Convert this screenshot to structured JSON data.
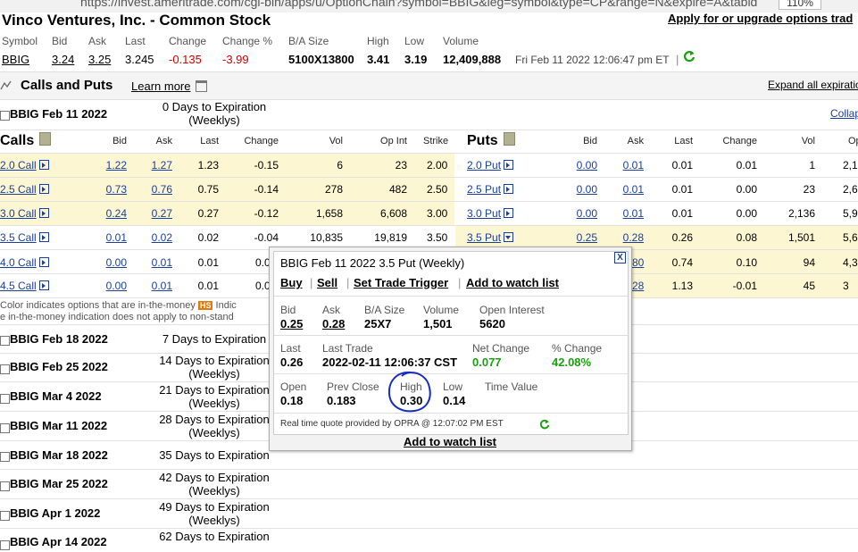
{
  "browser": {
    "url": "https://invest.ameritrade.com/cgi-bin/apps/u/OptionChain?symbol=BBIG&leg=symbol&type=CP&range=N&expire=A&tabid",
    "zoom": "110%"
  },
  "header": {
    "title": "Vinco Ventures, Inc. - Common Stock",
    "apply_link": "Apply for or upgrade options trad"
  },
  "quote": {
    "labels": {
      "symbol": "Symbol",
      "bid": "Bid",
      "ask": "Ask",
      "last": "Last",
      "change": "Change",
      "change_pct": "Change %",
      "ba_size": "B/A Size",
      "high": "High",
      "low": "Low",
      "volume": "Volume"
    },
    "values": {
      "symbol": "BBIG",
      "bid": "3.24",
      "ask": "3.25",
      "last": "3.245",
      "change": "-0.135",
      "change_pct": "-3.99",
      "ba_size": "5100X13800",
      "high": "3.41",
      "low": "3.19",
      "volume": "12,409,888",
      "timestamp": "Fri Feb 11 2022 12:06:47 pm ET",
      "pipe": "|"
    }
  },
  "section": {
    "title": "Calls and Puts",
    "learn_more": "Learn more",
    "expand_all": "Expand all expiratio"
  },
  "expiry_open": {
    "label": "BBIG Feb 11 2022",
    "days": "0 Days to Expiration",
    "weekly": "(Weeklys)",
    "collapse": "Collap"
  },
  "chain_headers": {
    "calls": "Calls",
    "puts": "Puts",
    "bid": "Bid",
    "ask": "Ask",
    "last": "Last",
    "change": "Change",
    "vol": "Vol",
    "op_int": "Op Int",
    "strike": "Strike"
  },
  "chain_rows": [
    {
      "call": "2.0 Call",
      "c_bid": "1.22",
      "c_ask": "1.27",
      "c_last": "1.23",
      "c_chg": "-0.15",
      "c_vol": "6",
      "c_oi": "23",
      "strike": "2.00",
      "put": "2.0 Put",
      "p_bid": "0.00",
      "p_ask": "0.01",
      "p_last": "0.01",
      "p_chg": "0.01",
      "p_vol": "1",
      "p_oi": "2,1"
    },
    {
      "call": "2.5 Call",
      "c_bid": "0.73",
      "c_ask": "0.76",
      "c_last": "0.75",
      "c_chg": "-0.14",
      "c_vol": "278",
      "c_oi": "482",
      "strike": "2.50",
      "put": "2.5 Put",
      "p_bid": "0.00",
      "p_ask": "0.01",
      "p_last": "0.01",
      "p_chg": "0.00",
      "p_vol": "23",
      "p_oi": "2,6"
    },
    {
      "call": "3.0 Call",
      "c_bid": "0.24",
      "c_ask": "0.27",
      "c_last": "0.27",
      "c_chg": "-0.12",
      "c_vol": "1,658",
      "c_oi": "6,608",
      "strike": "3.00",
      "put": "3.0 Put",
      "p_bid": "0.00",
      "p_ask": "0.01",
      "p_last": "0.01",
      "p_chg": "0.00",
      "p_vol": "2,136",
      "p_oi": "5,9"
    },
    {
      "call": "3.5 Call",
      "c_bid": "0.01",
      "c_ask": "0.02",
      "c_last": "0.02",
      "c_chg": "-0.04",
      "c_vol": "10,835",
      "c_oi": "19,819",
      "strike": "3.50",
      "put": "3.5 Put",
      "p_bid": "0.25",
      "p_ask": "0.28",
      "p_last": "0.26",
      "p_chg": "0.08",
      "p_vol": "1,501",
      "p_oi": "5,6"
    },
    {
      "call": "4.0 Call",
      "c_bid": "0.00",
      "c_ask": "0.01",
      "c_last": "0.01",
      "c_chg": "0.0",
      "p_ask": "80",
      "p_last": "0.74",
      "p_chg": "0.10",
      "p_vol": "94",
      "p_oi": "4,3"
    },
    {
      "call": "4.5 Call",
      "c_bid": "0.00",
      "c_ask": "0.01",
      "c_last": "0.01",
      "c_chg": "0.0",
      "p_ask": "28",
      "p_last": "1.13",
      "p_chg": "-0.01",
      "p_vol": "45",
      "p_oi": "3"
    }
  ],
  "legend": {
    "line1": "Color indicates options that are in-the-money",
    "badge": "HS",
    "line1_tail": "Indic",
    "line2": "e in-the-money indication does not apply to non-stand"
  },
  "expirations": [
    {
      "label": "BBIG Feb 18 2022",
      "days": "7 Days to Expiration",
      "weekly": ""
    },
    {
      "label": "BBIG Feb 25 2022",
      "days": "14 Days to Expiration",
      "weekly": "(Weeklys)"
    },
    {
      "label": "BBIG Mar 4 2022",
      "days": "21 Days to Expiration",
      "weekly": "(Weeklys)"
    },
    {
      "label": "BBIG Mar 11 2022",
      "days": "28 Days to Expiration",
      "weekly": "(Weeklys)"
    },
    {
      "label": "BBIG Mar 18 2022",
      "days": "35 Days to Expiration",
      "weekly": ""
    },
    {
      "label": "BBIG Mar 25 2022",
      "days": "42 Days to Expiration",
      "weekly": "(Weeklys)"
    },
    {
      "label": "BBIG Apr 1 2022",
      "days": "49 Days to Expiration",
      "weekly": "(Weeklys)"
    },
    {
      "label": "BBIG Apr 14 2022",
      "days": "62 Days to Expiration",
      "weekly": ""
    }
  ],
  "popup": {
    "title": "BBIG Feb 11 2022 3.5 Put (Weekly)",
    "close": "X",
    "actions": {
      "buy": "Buy",
      "sell": "Sell",
      "trigger": "Set Trade Trigger",
      "watch": "Add to watch list",
      "sep": "|"
    },
    "labels": {
      "bid": "Bid",
      "ask": "Ask",
      "ba_size": "B/A Size",
      "volume": "Volume",
      "open_interest": "Open Interest",
      "last": "Last",
      "last_trade": "Last Trade",
      "net_change": "Net Change",
      "pct_change": "% Change",
      "open": "Open",
      "prev_close": "Prev Close",
      "high": "High",
      "low": "Low",
      "time_value": "Time Value"
    },
    "values": {
      "bid": "0.25",
      "ask": "0.28",
      "ba_size": "25X7",
      "volume": "1,501",
      "open_interest": "5620",
      "last": "0.26",
      "last_trade": "2022-02-11 12:06:37 CST",
      "net_change": "0.077",
      "pct_change": "42.08%",
      "open": "0.18",
      "prev_close": "0.183",
      "high": "0.30",
      "low": "0.14"
    },
    "footer": "Real time quote provided by OPRA @ 12:07:02 PM EST",
    "bottom_watch": "Add to watch list"
  },
  "colors": {
    "itm_yellow": "#fdf6d2",
    "link_blue": "#1a3f9c",
    "negative_red": "#d00000",
    "positive_green": "#19a00e",
    "annotation_blue": "#1a2dbf"
  }
}
